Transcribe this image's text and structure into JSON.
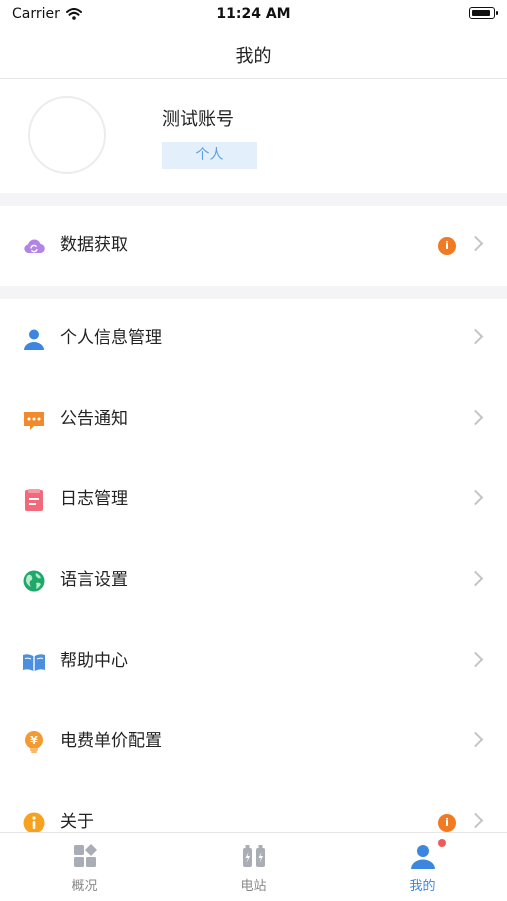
{
  "status_bar": {
    "carrier": "Carrier",
    "time": "11:24 AM"
  },
  "nav": {
    "title": "我的"
  },
  "profile": {
    "account_name": "测试账号",
    "account_type": "个人"
  },
  "menu": {
    "data_fetch": {
      "label": "数据获取",
      "icon": "cloud-sync-icon",
      "badge": "i"
    },
    "personal_info": {
      "label": "个人信息管理",
      "icon": "user-icon"
    },
    "announcement": {
      "label": "公告通知",
      "icon": "message-icon"
    },
    "log_management": {
      "label": "日志管理",
      "icon": "document-icon"
    },
    "language": {
      "label": "语言设置",
      "icon": "globe-icon"
    },
    "help": {
      "label": "帮助中心",
      "icon": "book-icon"
    },
    "electricity_price": {
      "label": "电费单价配置",
      "icon": "price-bulb-icon"
    },
    "about": {
      "label": "关于",
      "icon": "info-icon",
      "badge": "i"
    }
  },
  "tabs": [
    {
      "label": "概况",
      "icon": "dashboard-icon"
    },
    {
      "label": "电站",
      "icon": "station-icon"
    },
    {
      "label": "我的",
      "icon": "profile-icon",
      "active": true
    }
  ],
  "colors": {
    "accent": "#3d86e0",
    "badge": "#f07b23",
    "tag_bg": "#e3f0fc",
    "section_gap": "#f4f4f6"
  }
}
